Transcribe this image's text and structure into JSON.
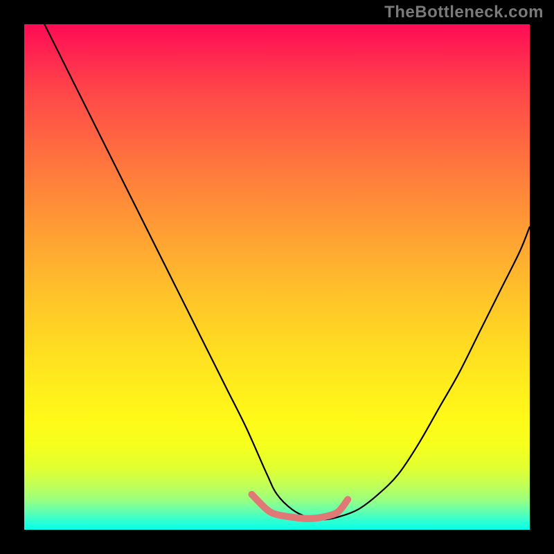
{
  "watermark": "TheBottleneck.com",
  "chart_data": {
    "type": "line",
    "title": "",
    "xlabel": "",
    "ylabel": "",
    "xlim": [
      0,
      100
    ],
    "ylim": [
      0,
      100
    ],
    "grid": false,
    "annotations": "V-shaped bottleneck curve over red-to-green vertical gradient; minimum plateau near x≈50–60; pink/red segment overlay at minimum.",
    "series": [
      {
        "name": "bottleneck-curve",
        "color": "#000000",
        "x": [
          4,
          8,
          12,
          16,
          20,
          24,
          28,
          32,
          36,
          40,
          44,
          48,
          50,
          53,
          56,
          59,
          62,
          66,
          70,
          74,
          78,
          82,
          86,
          90,
          94,
          98,
          100
        ],
        "y": [
          100,
          92,
          84,
          76,
          68,
          60,
          52,
          44,
          36,
          28,
          20,
          11,
          7,
          4,
          2.5,
          2,
          2.5,
          4,
          7,
          11,
          17,
          24,
          31,
          39,
          47,
          55,
          60
        ]
      },
      {
        "name": "optimal-zone-overlay",
        "color": "#e07878",
        "x": [
          45,
          48,
          50,
          53,
          56,
          59,
          62,
          64
        ],
        "y": [
          7,
          4,
          3,
          2.5,
          2.2,
          2.5,
          3.5,
          6
        ]
      }
    ],
    "gradient_stops": [
      {
        "pos": 0,
        "color": "#ff0b54"
      },
      {
        "pos": 50,
        "color": "#ffc429"
      },
      {
        "pos": 80,
        "color": "#fff918"
      },
      {
        "pos": 100,
        "color": "#05ffe9"
      }
    ]
  }
}
